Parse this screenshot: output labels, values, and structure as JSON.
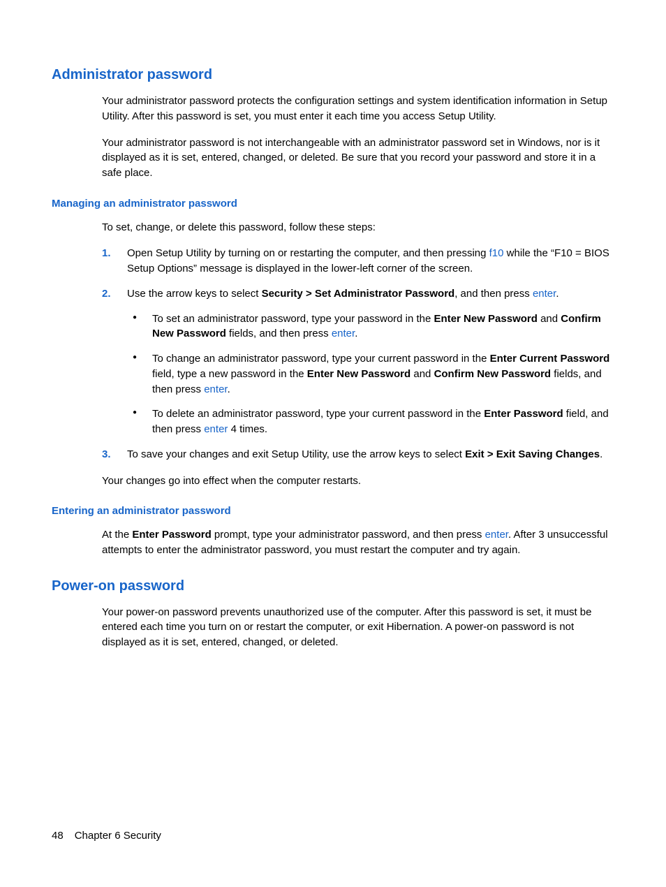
{
  "colors": {
    "link": "#1865c9"
  },
  "h2a": "Administrator password",
  "p1": "Your administrator password protects the configuration settings and system identification information in Setup Utility. After this password is set, you must enter it each time you access Setup Utility.",
  "p2": "Your administrator password is not interchangeable with an administrator password set in Windows, nor is it displayed as it is set, entered, changed, or deleted. Be sure that you record your password and store it in a safe place.",
  "h3a": "Managing an administrator password",
  "p3": "To set, change, or delete this password, follow these steps:",
  "step1_a": "Open Setup Utility by turning on or restarting the computer, and then pressing ",
  "step1_key": "f10",
  "step1_b": " while the “F10 = BIOS Setup Options” message is displayed in the lower-left corner of the screen.",
  "step2_a": "Use the arrow keys to select ",
  "step2_bold": "Security > Set Administrator Password",
  "step2_b": ", and then press ",
  "step2_key": "enter",
  "step2_c": ".",
  "b1_a": "To set an administrator password, type your password in the ",
  "b1_bold1": "Enter New Password",
  "b1_b": " and ",
  "b1_bold2": "Confirm New Password",
  "b1_c": " fields, and then press ",
  "b1_key": "enter",
  "b1_d": ".",
  "b2_a": "To change an administrator password, type your current password in the ",
  "b2_bold1": "Enter Current Password",
  "b2_b": " field, type a new password in the ",
  "b2_bold2": "Enter New Password",
  "b2_c": " and ",
  "b2_bold3": "Confirm New Password",
  "b2_d": " fields, and then press ",
  "b2_key": "enter",
  "b2_e": ".",
  "b3_a": "To delete an administrator password, type your current password in the ",
  "b3_bold1": "Enter Password",
  "b3_b": " field, and then press ",
  "b3_key": "enter",
  "b3_c": " 4 times.",
  "step3_a": "To save your changes and exit Setup Utility, use the arrow keys to select ",
  "step3_bold": "Exit > Exit Saving Changes",
  "step3_b": ".",
  "p4": "Your changes go into effect when the computer restarts.",
  "h3b": "Entering an administrator password",
  "p5_a": "At the ",
  "p5_bold": "Enter Password",
  "p5_b": " prompt, type your administrator password, and then press ",
  "p5_key": "enter",
  "p5_c": ". After 3 unsuccessful attempts to enter the administrator password, you must restart the computer and try again.",
  "h2b": "Power-on password",
  "p6": "Your power-on password prevents unauthorized use of the computer. After this password is set, it must be entered each time you turn on or restart the computer, or exit Hibernation. A power-on password is not displayed as it is set, entered, changed, or deleted.",
  "footer": {
    "page": "48",
    "chapter": "Chapter 6   Security"
  }
}
